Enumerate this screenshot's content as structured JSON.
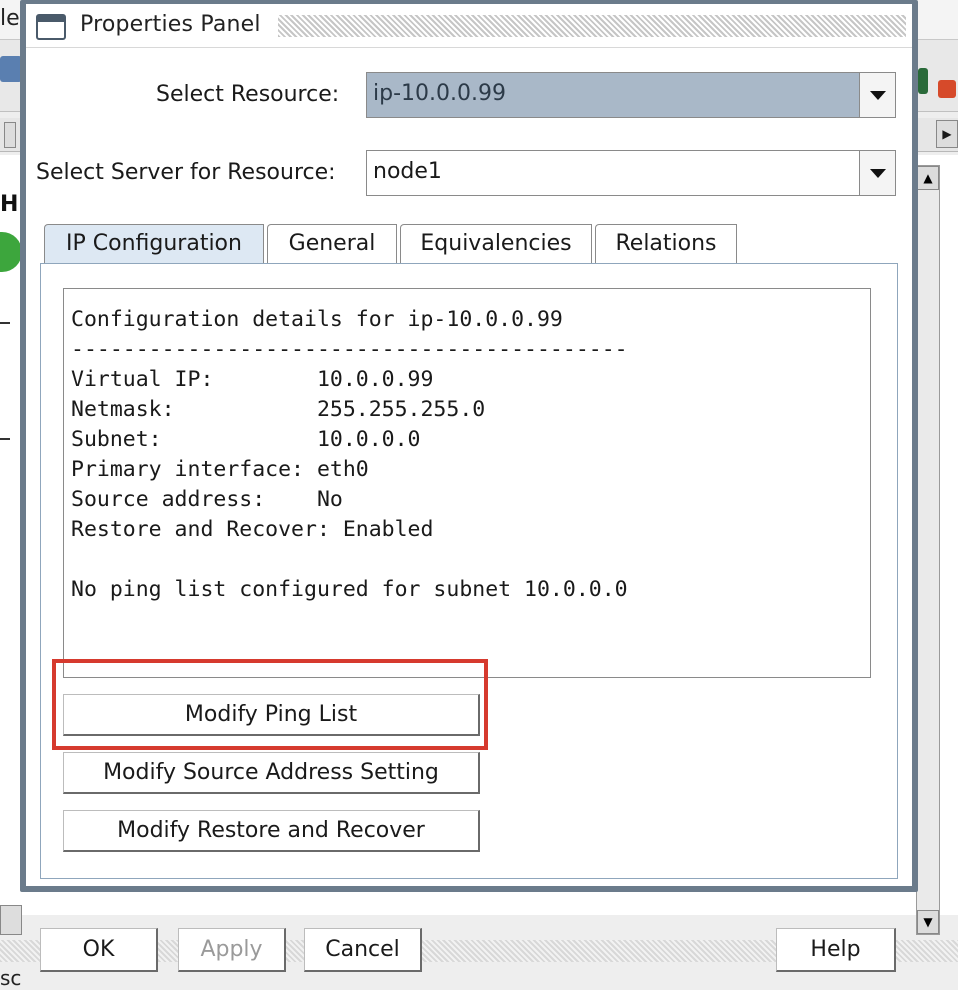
{
  "background_app": {
    "title_fragment": "le",
    "bottom_fragment": "sc",
    "left_letter": "H"
  },
  "dialog": {
    "title": "Properties Panel",
    "select_resource_label": "Select Resource:",
    "select_resource_value": "ip-10.0.0.99",
    "select_server_label": "Select Server for Resource:",
    "select_server_value": "node1",
    "tabs": [
      {
        "label": "IP Configuration",
        "active": true
      },
      {
        "label": "General",
        "active": false
      },
      {
        "label": "Equivalencies",
        "active": false
      },
      {
        "label": "Relations",
        "active": false
      }
    ],
    "details_lines": [
      "Configuration details for ip-10.0.0.99",
      "-------------------------------------------",
      "Virtual IP:        10.0.0.99",
      "Netmask:           255.255.255.0",
      "Subnet:            10.0.0.0",
      "Primary interface: eth0",
      "Source address:    No",
      "Restore and Recover: Enabled",
      "",
      "No ping list configured for subnet 10.0.0.0"
    ],
    "buttons": {
      "modify_ping_list": "Modify Ping List",
      "modify_source_address": "Modify Source Address Setting",
      "modify_restore_recover": "Modify Restore and Recover"
    }
  },
  "footer": {
    "ok": "OK",
    "apply": "Apply",
    "cancel": "Cancel",
    "help": "Help"
  },
  "colors": {
    "highlight": "#d63a2e",
    "selected_combo": "#a9b8c8",
    "active_tab": "#dde8f3",
    "dialog_frame": "#6b7b8b"
  }
}
